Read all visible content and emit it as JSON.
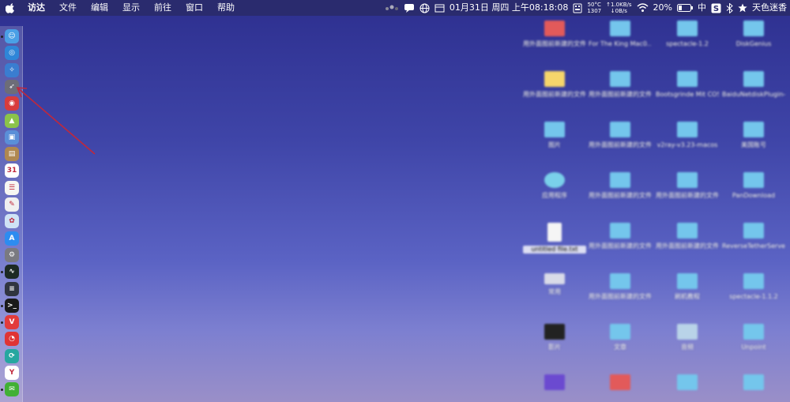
{
  "menubar": {
    "items": [
      "访达",
      "文件",
      "编辑",
      "显示",
      "前往",
      "窗口",
      "帮助"
    ],
    "status": {
      "temp": "50°C",
      "rpm": "1307",
      "net_up": "↑1.0KB/s",
      "net_down": "↓0B/s",
      "datetime": "01月31日 周四 上午08:18:08",
      "battery": "20%",
      "input_method": "中",
      "user": "天色迷香"
    }
  },
  "colors": {
    "menubar_bg": "#2a2b6e",
    "desktop_top": "#2d2f8f",
    "desktop_bottom": "#9a8fc8",
    "arrow": "#c0283c"
  },
  "dock": {
    "items": [
      {
        "name": "finder-icon",
        "color": "#4aa0e6",
        "glyph": "☺",
        "running": true
      },
      {
        "name": "safari-icon",
        "color": "#2f86d8",
        "glyph": "◎",
        "running": false
      },
      {
        "name": "safari-compass-icon",
        "color": "#3a7dd0",
        "glyph": "✧",
        "running": false
      },
      {
        "name": "launchpad-rocket-icon",
        "color": "#6d6d78",
        "glyph": "➶",
        "running": false
      },
      {
        "name": "notification-app-icon",
        "color": "#d83c3c",
        "glyph": "◉",
        "running": false
      },
      {
        "name": "android-icon",
        "color": "#8bc34a",
        "glyph": "▲",
        "running": false
      },
      {
        "name": "preview-icon",
        "color": "#5a8fd8",
        "glyph": "▣",
        "running": false
      },
      {
        "name": "notes-book-icon",
        "color": "#b08850",
        "glyph": "▤",
        "running": false
      },
      {
        "name": "calendar-icon",
        "color": "#ffffff",
        "glyph": "31",
        "running": false
      },
      {
        "name": "reminders-icon",
        "color": "#f7f7f2",
        "glyph": "☰",
        "running": false
      },
      {
        "name": "textedit-icon",
        "color": "#f0f0f0",
        "glyph": "✎",
        "running": false
      },
      {
        "name": "photos-icon",
        "color": "#cfe3f5",
        "glyph": "✿",
        "running": false
      },
      {
        "name": "app-store-icon",
        "color": "#2d8cf0",
        "glyph": "A",
        "running": false
      },
      {
        "name": "system-preferences-icon",
        "color": "#7a7a80",
        "glyph": "⚙",
        "running": false
      },
      {
        "name": "activity-monitor-icon",
        "color": "#1d2a24",
        "glyph": "∿",
        "running": true
      },
      {
        "name": "console-icon",
        "color": "#303540",
        "glyph": "≡",
        "running": false
      },
      {
        "name": "terminal-icon",
        "color": "#1a1a1a",
        "glyph": ">_",
        "running": true
      },
      {
        "name": "vivaldi-icon",
        "color": "#e23b3b",
        "glyph": "V",
        "running": true
      },
      {
        "name": "netease-music-icon",
        "color": "#e03434",
        "glyph": "◔",
        "running": false
      },
      {
        "name": "sync-icon",
        "color": "#26a7a0",
        "glyph": "⟳",
        "running": false
      },
      {
        "name": "yandex-icon",
        "color": "#ffffff",
        "glyph": "Y",
        "running": false
      },
      {
        "name": "wechat-icon",
        "color": "#41b035",
        "glyph": "✉",
        "running": true
      }
    ]
  },
  "desktop": {
    "icons": [
      {
        "label": "用外面图前新建的文件夹 4",
        "kind": "folder-red"
      },
      {
        "label": "For The King Mac0...HATSD",
        "kind": "folder"
      },
      {
        "label": "spectacle-1.2",
        "kind": "folder"
      },
      {
        "label": "DiskGenius",
        "kind": "folder"
      },
      {
        "label": "用外面图前新建的文件夹 2",
        "kind": "folder-yellow"
      },
      {
        "label": "用外面图前新建的文件夹 10",
        "kind": "folder"
      },
      {
        "label": "Bootsgrinde Mit COSX-GOD",
        "kind": "folder"
      },
      {
        "label": "BaiduNetdiskPlugin-ma...master",
        "kind": "folder"
      },
      {
        "label": "图片",
        "kind": "folder"
      },
      {
        "label": "用外面图前新建的文件夹 8",
        "kind": "folder"
      },
      {
        "label": "v2ray-v3.23-macos",
        "kind": "folder"
      },
      {
        "label": "美国账号",
        "kind": "folder"
      },
      {
        "label": "应用程序",
        "kind": "app"
      },
      {
        "label": "用外面图前新建的文件夹 6",
        "kind": "folder"
      },
      {
        "label": "用外面图前新建的文件夹 15",
        "kind": "folder"
      },
      {
        "label": "PanDownload",
        "kind": "folder"
      },
      {
        "label": "untitled file.txt",
        "kind": "doc"
      },
      {
        "label": "用外面图前新建的文件夹 7",
        "kind": "folder"
      },
      {
        "label": "用外面图前新建的文件夹 12",
        "kind": "folder"
      },
      {
        "label": "ReverseTetherServer_1.2.0",
        "kind": "folder"
      },
      {
        "label": "常用",
        "kind": "disk"
      },
      {
        "label": "用外面图前新建的文件夹 3",
        "kind": "folder"
      },
      {
        "label": "刷机教程",
        "kind": "folder"
      },
      {
        "label": "spectacle-1.1.2",
        "kind": "folder"
      },
      {
        "label": "影片",
        "kind": "app-dark"
      },
      {
        "label": "文章",
        "kind": "folder"
      },
      {
        "label": "音频",
        "kind": "folder-photo"
      },
      {
        "label": "Unpoint",
        "kind": "folder"
      },
      {
        "label": "",
        "kind": "app-photo"
      },
      {
        "label": "",
        "kind": "folder-red"
      },
      {
        "label": "",
        "kind": "folder"
      },
      {
        "label": "",
        "kind": "folder"
      }
    ]
  }
}
